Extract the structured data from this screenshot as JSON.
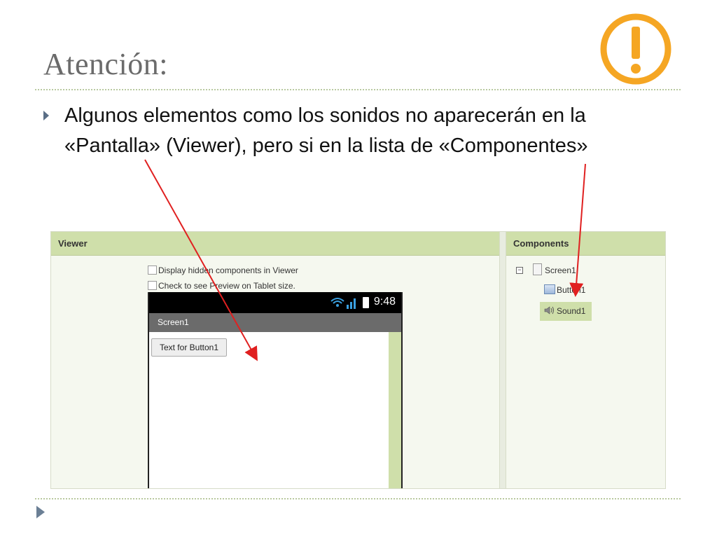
{
  "slide": {
    "title": "Atención:",
    "bullet_line1": "Algunos elementos como los sonidos no aparecerán en la",
    "bullet_line2": "«Pantalla» (Viewer), pero si en la lista de «Componentes»"
  },
  "viewer": {
    "header": "Viewer",
    "checkbox1_label": "Display hidden components in Viewer",
    "checkbox2_label": "Check to see Preview on Tablet size.",
    "phone": {
      "time": "9:48",
      "screen_title": "Screen1",
      "button_text": "Text for Button1"
    }
  },
  "components": {
    "header": "Components",
    "tree": [
      {
        "label": "Screen1",
        "icon": "screen-icon"
      },
      {
        "label": "Button1",
        "icon": "button-icon"
      },
      {
        "label": "Sound1",
        "icon": "sound-icon",
        "selected": true
      }
    ]
  },
  "colors": {
    "warning": "#f5a623",
    "arrow": "#e02020",
    "panel_header": "#cfdfaa",
    "title": "#6b6b6b"
  }
}
